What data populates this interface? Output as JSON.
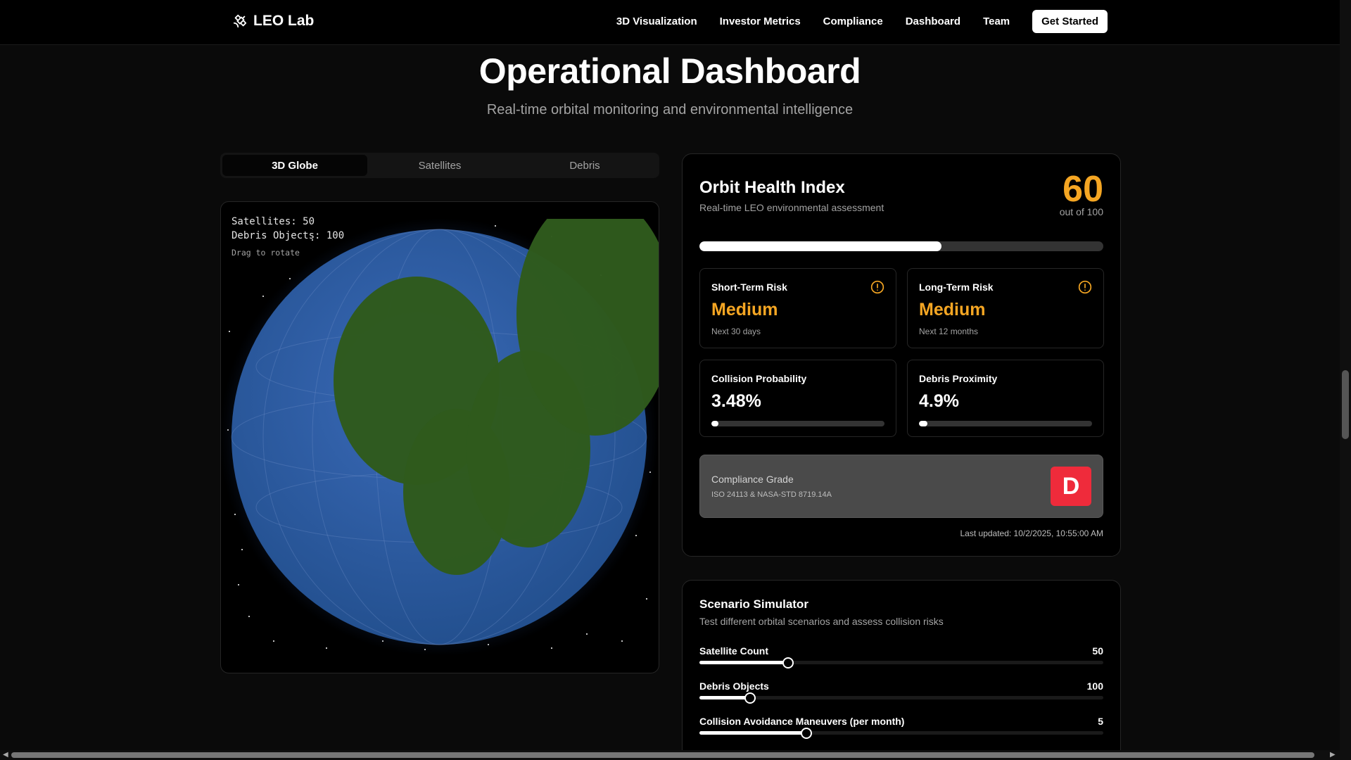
{
  "nav": {
    "brand": "LEO Lab",
    "links": [
      "3D Visualization",
      "Investor Metrics",
      "Compliance",
      "Dashboard",
      "Team"
    ],
    "cta": "Get Started"
  },
  "header": {
    "title": "Operational Dashboard",
    "subtitle": "Real-time orbital monitoring and environmental intelligence"
  },
  "tabs": [
    {
      "label": "3D Globe",
      "active": true
    },
    {
      "label": "Satellites",
      "active": false
    },
    {
      "label": "Debris",
      "active": false
    }
  ],
  "globe": {
    "satellites_line": "Satellites: 50",
    "debris_line": "Debris Objects: 100",
    "hint": "Drag to rotate"
  },
  "health": {
    "title": "Orbit Health Index",
    "subtitle": "Real-time LEO environmental assessment",
    "score": "60",
    "out_of": "out of 100",
    "score_fraction": 0.6,
    "short_term": {
      "label": "Short-Term Risk",
      "value": "Medium",
      "note": "Next 30 days"
    },
    "long_term": {
      "label": "Long-Term Risk",
      "value": "Medium",
      "note": "Next 12 months"
    },
    "collision": {
      "label": "Collision Probability",
      "value": "3.48%",
      "fraction": 0.0348
    },
    "proximity": {
      "label": "Debris Proximity",
      "value": "4.9%",
      "fraction": 0.049
    },
    "compliance": {
      "label": "Compliance Grade",
      "standard": "ISO 24113 & NASA-STD 8719.14A",
      "grade": "D"
    },
    "updated": "Last updated: 10/2/2025, 10:55:00 AM"
  },
  "scenario": {
    "title": "Scenario Simulator",
    "subtitle": "Test different orbital scenarios and assess collision risks",
    "sliders": [
      {
        "label": "Satellite Count",
        "value": "50",
        "fraction": 0.22
      },
      {
        "label": "Debris Objects",
        "value": "100",
        "fraction": 0.125
      },
      {
        "label": "Collision Avoidance Maneuvers (per month)",
        "value": "5",
        "fraction": 0.265
      }
    ]
  },
  "colors": {
    "accent_amber": "#f5a623",
    "grade_red": "#ef2b3b",
    "ocean_blue": "#2f5fa8",
    "land_green": "#2f5a1d"
  }
}
